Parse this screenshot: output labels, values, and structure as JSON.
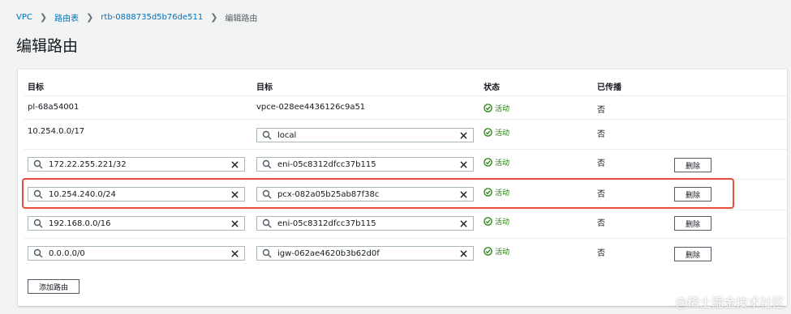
{
  "breadcrumb": {
    "items": [
      "VPC",
      "路由表",
      "rtb-0888735d5b76de511"
    ],
    "current": "编辑路由"
  },
  "page_title": "编辑路由",
  "table": {
    "headers": {
      "destination": "目标",
      "target": "目标",
      "status": "状态",
      "propagated": "已传播"
    },
    "rows": [
      {
        "destination": "pl-68a54001",
        "target": "vpce-028ee4436126c9a51",
        "status": "活动",
        "propagated": "否"
      },
      {
        "destination": "10.254.0.0/17",
        "target": "local",
        "status": "活动",
        "propagated": "否"
      },
      {
        "destination": "172.22.255.221/32",
        "target": "eni-05c8312dfcc37b115",
        "status": "活动",
        "propagated": "否",
        "remove": "删除"
      },
      {
        "destination": "10.254.240.0/24",
        "target": "pcx-082a05b25ab87f38c",
        "status": "活动",
        "propagated": "否",
        "remove": "删除"
      },
      {
        "destination": "192.168.0.0/16",
        "target": "eni-05c8312dfcc37b115",
        "status": "活动",
        "propagated": "否",
        "remove": "删除"
      },
      {
        "destination": "0.0.0.0/0",
        "target": "igw-062ae4620b3b62d0f",
        "status": "活动",
        "propagated": "否",
        "remove": "删除"
      }
    ]
  },
  "add_route_label": "添加路由",
  "watermark": "@稀土掘金技术社区",
  "colors": {
    "link": "#0073bb",
    "status_ok": "#1d8102",
    "highlight": "#e74c3c",
    "border": "#aab7b8"
  },
  "icons": {
    "breadcrumb_separator": "chevron-right-icon",
    "field_search": "search-icon",
    "field_clear": "close-icon",
    "status": "check-circle-icon"
  }
}
